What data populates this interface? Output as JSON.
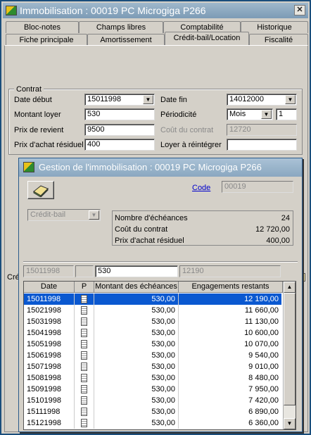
{
  "window": {
    "title": "Immobilisation : 00019 PC  Microgiga P266",
    "close_glyph": "✕"
  },
  "tabs_top": [
    {
      "label": "Bloc-notes"
    },
    {
      "label": "Champs libres"
    },
    {
      "label": "Comptabilité"
    },
    {
      "label": "Historique"
    }
  ],
  "tabs_bottom": [
    {
      "label": "Fiche principale"
    },
    {
      "label": "Amortissement"
    },
    {
      "label": "Crédit-bail/Location",
      "active": true
    },
    {
      "label": "Fiscalité"
    }
  ],
  "contrat": {
    "legend": "Contrat",
    "date_debut_label": "Date début",
    "date_debut_value": "15011998",
    "date_fin_label": "Date fin",
    "date_fin_value": "14012000",
    "montant_loyer_label": "Montant loyer",
    "montant_loyer_value": "530",
    "periodicite_label": "Périodicité",
    "periodicite_value": "Mois",
    "periodicite_count": "1",
    "prix_revient_label": "Prix de revient",
    "prix_revient_value": "9500",
    "cout_contrat_label": "Coût du contrat",
    "cout_contrat_value": "12720",
    "prix_achat_label": "Prix d'achat résiduel",
    "prix_achat_value": "400",
    "loyer_reintegrer_label": "Loyer à réintégrer",
    "loyer_reintegrer_value": ""
  },
  "behind_label_partial": "Cré",
  "dialog": {
    "title": "Gestion de l'immobilisation : 00019 PC  Microgiga P266",
    "code_label": "Code",
    "code_value": "00019",
    "type_select": "Crédit-bail",
    "info": {
      "nb_echeances_label": "Nombre d'échéances",
      "nb_echeances_value": "24",
      "cout_contrat_label": "Coût du contrat",
      "cout_contrat_value": "12 720,00",
      "prix_achat_label": "Prix d'achat résiduel",
      "prix_achat_value": "400,00"
    },
    "edit_row": {
      "date": "15011998",
      "p": "",
      "montant": "530",
      "engagement": "12190"
    },
    "grid": {
      "headers": [
        "Date",
        "P",
        "Montant des échéances",
        "Engagements restants"
      ],
      "rows": [
        {
          "date": "15011998",
          "montant": "530,00",
          "engagement": "12 190,00",
          "selected": true
        },
        {
          "date": "15021998",
          "montant": "530,00",
          "engagement": "11 660,00"
        },
        {
          "date": "15031998",
          "montant": "530,00",
          "engagement": "11 130,00"
        },
        {
          "date": "15041998",
          "montant": "530,00",
          "engagement": "10 600,00"
        },
        {
          "date": "15051998",
          "montant": "530,00",
          "engagement": "10 070,00"
        },
        {
          "date": "15061998",
          "montant": "530,00",
          "engagement": "9 540,00"
        },
        {
          "date": "15071998",
          "montant": "530,00",
          "engagement": "9 010,00"
        },
        {
          "date": "15081998",
          "montant": "530,00",
          "engagement": "8 480,00"
        },
        {
          "date": "15091998",
          "montant": "530,00",
          "engagement": "7 950,00"
        },
        {
          "date": "15101998",
          "montant": "530,00",
          "engagement": "7 420,00"
        },
        {
          "date": "15111998",
          "montant": "530,00",
          "engagement": "6 890,00"
        },
        {
          "date": "15121998",
          "montant": "530,00",
          "engagement": "6 360,00"
        }
      ]
    }
  },
  "colors": {
    "selection": "#0a58d0",
    "link": "#0000cc"
  }
}
